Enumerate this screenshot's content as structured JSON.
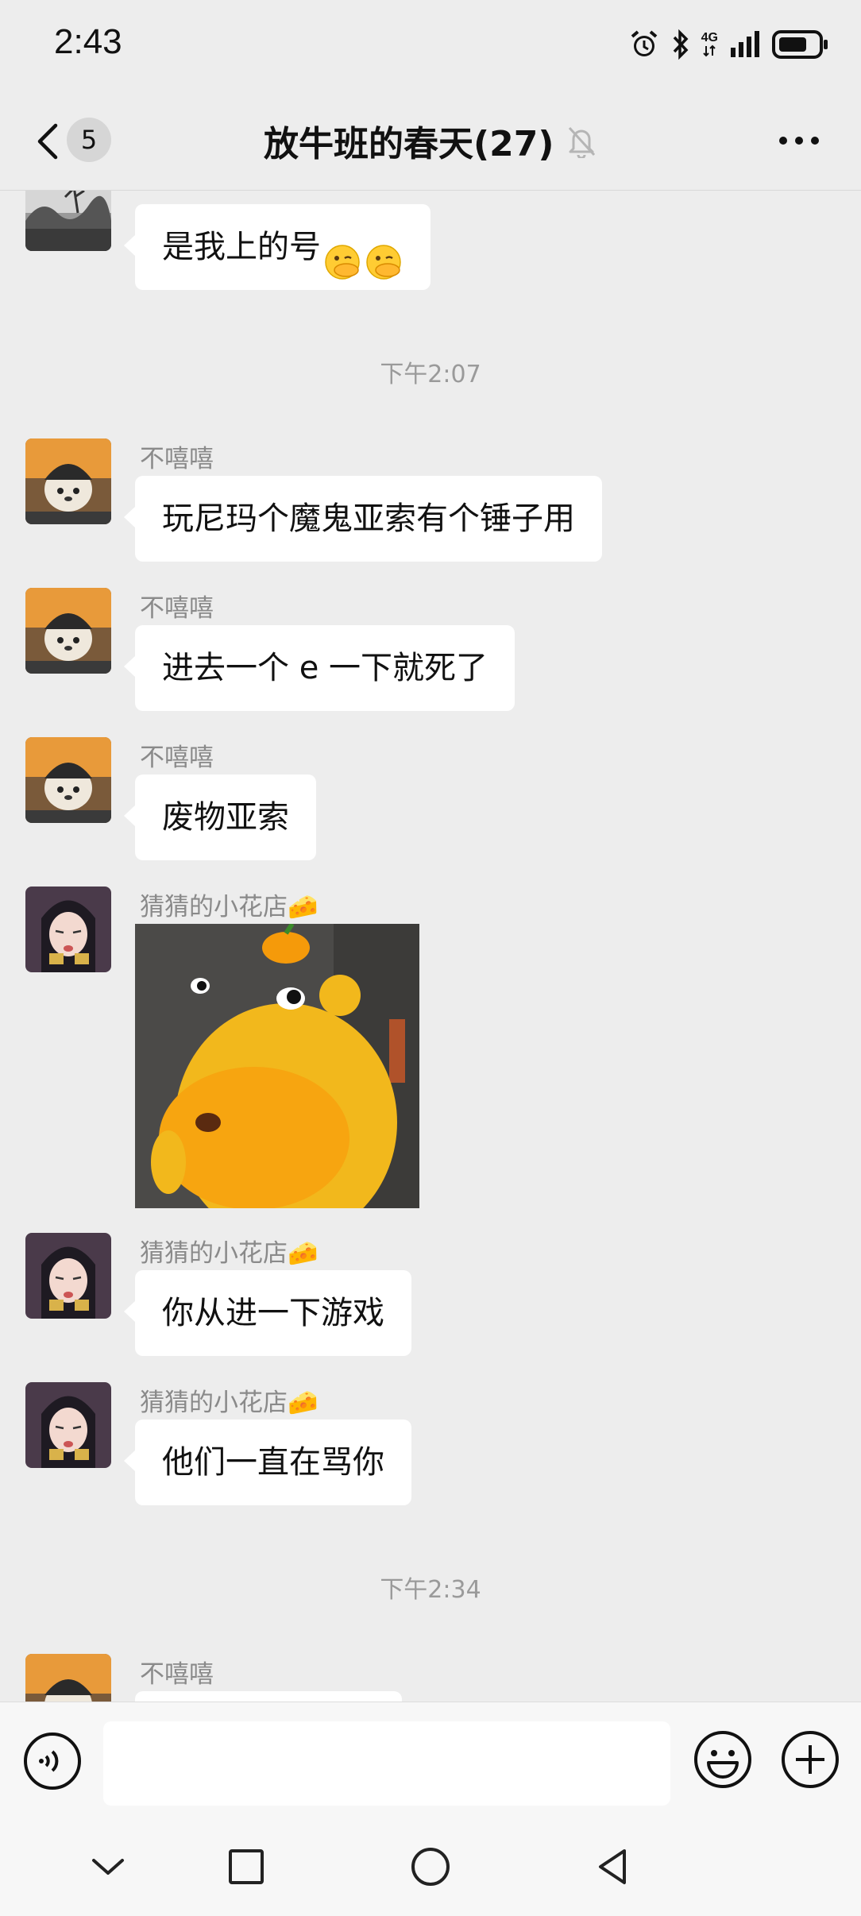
{
  "status_bar": {
    "time": "2:43",
    "network": "4G",
    "icons": [
      "alarm-icon",
      "bluetooth-icon",
      "signal-icon",
      "battery-icon"
    ]
  },
  "header": {
    "unread_count": "5",
    "title": "放牛班的春天(27)",
    "icons": [
      "back-icon",
      "mute-icon",
      "more-icon"
    ]
  },
  "messages": [
    {
      "sender": "",
      "text": "是我上的号",
      "emoji": [
        "face-with-hand-over-mouth",
        "face-with-hand-over-mouth"
      ]
    },
    {
      "timestamp": "下午2:07"
    },
    {
      "sender": "不嘻嘻",
      "text": "玩尼玛个魔鬼亚索有个锤子用"
    },
    {
      "sender": "不嘻嘻",
      "text": "进去一个 e 一下就死了"
    },
    {
      "sender": "不嘻嘻",
      "text": "废物亚索"
    },
    {
      "sender": "猜猜的小花店🧀",
      "sticker": "yellow-capybara-sticker"
    },
    {
      "sender": "猜猜的小花店🧀",
      "text": "你从进一下游戏"
    },
    {
      "sender": "猜猜的小花店🧀",
      "text": "他们一直在骂你"
    },
    {
      "timestamp": "下午2:34"
    },
    {
      "sender": "不嘻嘻",
      "text": ""
    }
  ],
  "input_bar": {
    "value": "",
    "placeholder": "",
    "icons": [
      "voice-icon",
      "emoji-icon",
      "plus-icon"
    ]
  },
  "nav_bar": {
    "icons": [
      "chevron-down-icon",
      "square-icon",
      "home-circle-icon",
      "back-triangle-icon"
    ]
  },
  "colors": {
    "background": "#ededed",
    "bubble": "#ffffff",
    "sender_text": "#8a8a8a",
    "timestamp_text": "#9a9a9a"
  }
}
